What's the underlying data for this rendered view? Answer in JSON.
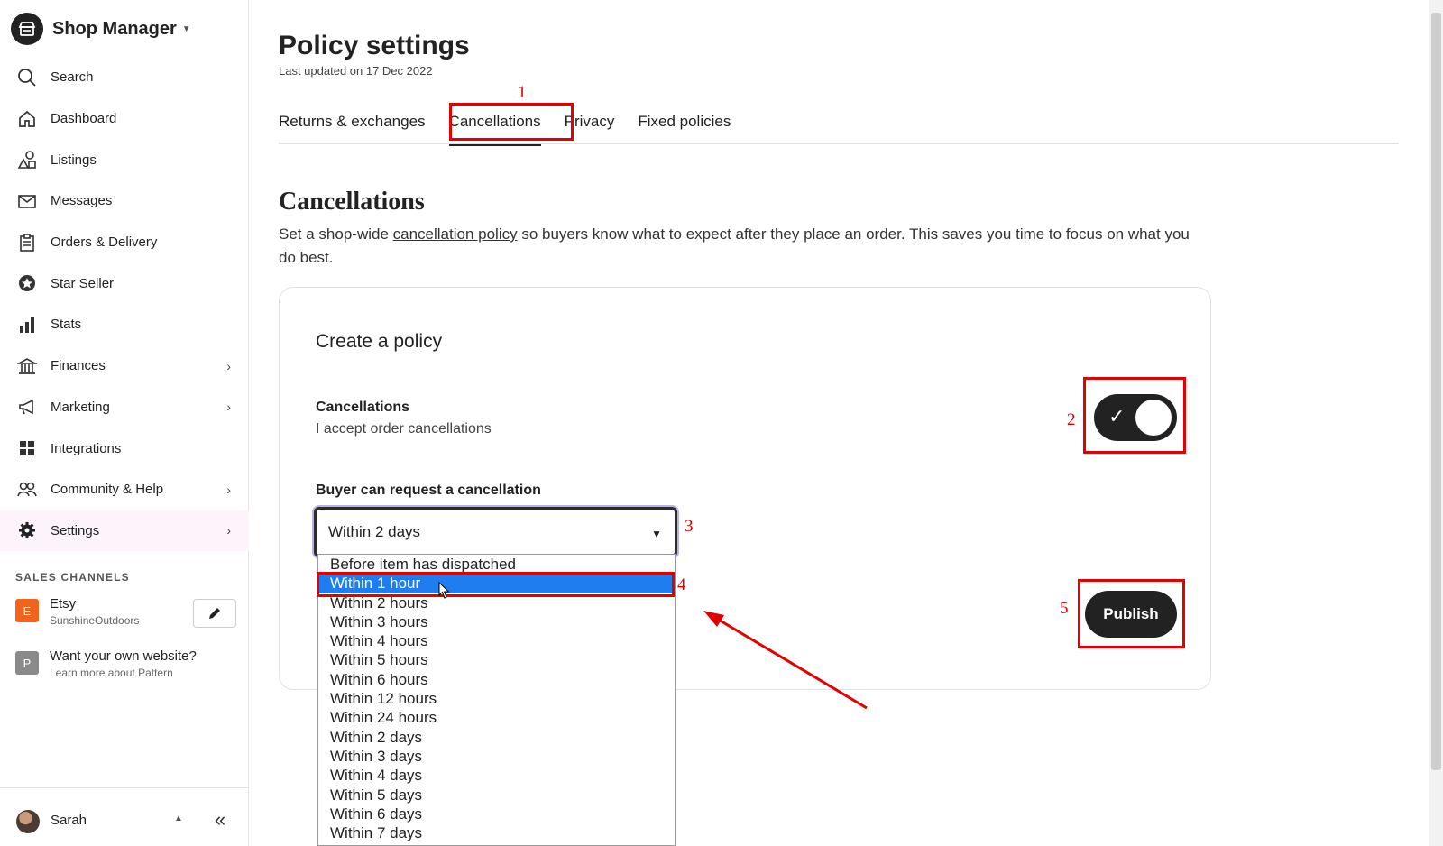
{
  "sidebar": {
    "brand": "Shop Manager",
    "items": [
      {
        "label": "Search"
      },
      {
        "label": "Dashboard"
      },
      {
        "label": "Listings"
      },
      {
        "label": "Messages"
      },
      {
        "label": "Orders & Delivery"
      },
      {
        "label": "Star Seller"
      },
      {
        "label": "Stats"
      },
      {
        "label": "Finances"
      },
      {
        "label": "Marketing"
      },
      {
        "label": "Integrations"
      },
      {
        "label": "Community & Help"
      },
      {
        "label": "Settings"
      }
    ],
    "sales_channels_title": "SALES CHANNELS",
    "channels": [
      {
        "badge": "E",
        "name": "Etsy",
        "sub": "SunshineOutdoors",
        "color": "#f1641e"
      },
      {
        "badge": "P",
        "name": "Want your own website?",
        "sub": "Learn more about Pattern",
        "color": "#8a8a8a"
      }
    ],
    "user": "Sarah"
  },
  "page": {
    "title": "Policy settings",
    "subtitle": "Last updated on 17 Dec 2022",
    "tabs": [
      "Returns & exchanges",
      "Cancellations",
      "Privacy",
      "Fixed policies"
    ]
  },
  "section": {
    "title": "Cancellations",
    "desc_before": "Set a shop-wide ",
    "desc_link": "cancellation policy",
    "desc_after": " so buyers know what to expect after they place an order. This saves you time to focus on what you do best."
  },
  "card": {
    "title": "Create a policy",
    "cancellations_label": "Cancellations",
    "cancellations_sub": "I accept order cancellations",
    "toggle_on": true,
    "buyer_label": "Buyer can request a cancellation",
    "selected": "Within 2 days",
    "publish": "Publish"
  },
  "dropdown": {
    "options": [
      "Before item has dispatched",
      "Within 1 hour",
      "Within 2 hours",
      "Within 3 hours",
      "Within 4 hours",
      "Within 5 hours",
      "Within 6 hours",
      "Within 12 hours",
      "Within 24 hours",
      "Within 2 days",
      "Within 3 days",
      "Within 4 days",
      "Within 5 days",
      "Within 6 days",
      "Within 7 days"
    ],
    "highlighted": "Within 1 hour"
  },
  "annotations": [
    "1",
    "2",
    "3",
    "4",
    "5"
  ],
  "colors": {
    "annotation": "#e20000",
    "highlight": "#1e7ef0",
    "accent_dark": "#222222"
  }
}
